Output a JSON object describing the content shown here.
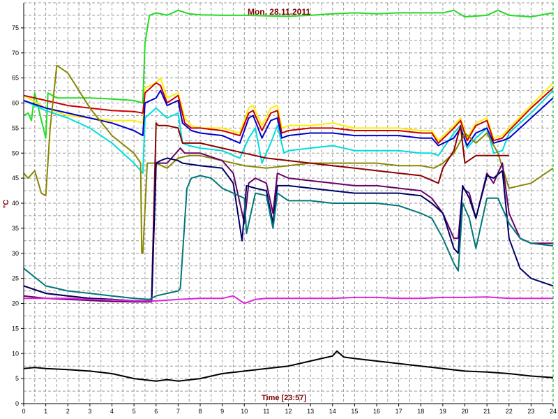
{
  "chart_data": {
    "type": "line",
    "title": "Mon. 28.11.2011",
    "xlabel": "Time [23:57]",
    "ylabel": "°C",
    "xlim": [
      0,
      24
    ],
    "ylim": [
      0,
      80
    ],
    "xticks": [
      "0",
      "1",
      "2",
      "3",
      "4",
      "5",
      "6",
      "7",
      "8",
      "9",
      "10",
      "11",
      "12",
      "13",
      "14",
      "15",
      "16",
      "17",
      "18",
      "19",
      "20",
      "21",
      "22",
      "23",
      "24"
    ],
    "yticks": [
      "0",
      "5",
      "10",
      "15",
      "20",
      "25",
      "30",
      "35",
      "40",
      "45",
      "50",
      "55",
      "60",
      "65",
      "70",
      "75"
    ],
    "grid": true,
    "legend": "none",
    "series": [
      {
        "color": "#22dd22",
        "x": [
          0,
          0.2,
          0.35,
          0.5,
          1,
          1.1,
          1.5,
          2,
          3,
          4,
          5,
          5.4,
          5.5,
          5.7,
          6,
          6.5,
          7,
          7.5,
          8,
          9,
          10,
          11,
          12,
          13,
          14,
          15,
          16,
          17,
          18,
          19,
          19.5,
          20,
          21,
          21.5,
          22,
          23,
          24
        ],
        "y": [
          57.5,
          58,
          56.5,
          62,
          53,
          62,
          61,
          61,
          61,
          60.8,
          60.5,
          60,
          72,
          77.5,
          78,
          77.5,
          78.5,
          77.8,
          77.6,
          77.5,
          77.5,
          77.4,
          77.3,
          77.5,
          77.8,
          78,
          77.8,
          78,
          78,
          78,
          78.5,
          77.2,
          77.5,
          78.5,
          77.5,
          77.2,
          78
        ]
      },
      {
        "color": "#ffee00",
        "x": [
          0,
          1,
          2,
          3,
          4,
          5,
          5.4,
          5.5,
          6,
          6.2,
          6.5,
          7,
          7.3,
          7.6,
          8,
          9,
          9.8,
          10.2,
          10.4,
          10.8,
          11.2,
          11.5,
          11.7,
          12,
          13,
          14,
          15,
          16,
          17,
          18,
          18.5,
          18.8,
          19.5,
          19.8,
          20.1,
          20.5,
          21,
          21.3,
          21.7,
          22,
          23,
          24
        ],
        "y": [
          61.5,
          59,
          57.5,
          57,
          56.5,
          56.5,
          56,
          63,
          64,
          65,
          61,
          62,
          57,
          55.5,
          55,
          55,
          54,
          59,
          59.5,
          55.5,
          59,
          59.5,
          55,
          55.5,
          55.5,
          56,
          55,
          55,
          55,
          54.5,
          54.5,
          52.5,
          55.5,
          57,
          53,
          56,
          57,
          53,
          53.5,
          55,
          59.5,
          64
        ]
      },
      {
        "color": "#cc0000",
        "x": [
          0,
          1,
          2,
          3,
          4,
          5,
          5.4,
          5.5,
          6,
          6.2,
          6.5,
          7,
          7.3,
          7.6,
          8,
          9,
          9.8,
          10.2,
          10.4,
          10.8,
          11.2,
          11.5,
          11.7,
          12,
          13,
          14,
          15,
          16,
          17,
          18,
          18.5,
          18.8,
          19.5,
          19.8,
          20.1,
          20.5,
          21,
          21.3,
          21.7,
          22,
          23,
          24
        ],
        "y": [
          61.5,
          60.5,
          59.5,
          59,
          58.5,
          58.3,
          58,
          62,
          64,
          63.5,
          60,
          61.5,
          56,
          55,
          55,
          54.5,
          53.5,
          58,
          58.5,
          54.5,
          58,
          58.5,
          54,
          54.5,
          55,
          55,
          54.5,
          54.5,
          54.5,
          54,
          54,
          52,
          55,
          56.5,
          52.5,
          55.5,
          56.5,
          52.5,
          53,
          54.5,
          59,
          63
        ]
      },
      {
        "color": "#00dddd",
        "x": [
          0,
          1,
          2,
          3,
          4,
          5,
          5.4,
          5.5,
          6,
          6.5,
          7,
          7.2,
          7.5,
          8,
          9,
          9.8,
          10.2,
          10.5,
          10.8,
          11.2,
          11.5,
          11.8,
          12,
          13,
          14,
          15,
          16,
          17,
          18,
          18.5,
          18.8,
          19.5,
          19.8,
          20.1,
          20.5,
          21,
          21.3,
          21.7,
          22,
          23,
          24
        ],
        "y": [
          60.5,
          58.5,
          57,
          55,
          52,
          48,
          46,
          57,
          59,
          57,
          58,
          52,
          51.5,
          51,
          50.5,
          49,
          53,
          55,
          48,
          52,
          55.5,
          50,
          50.5,
          51,
          51.5,
          50.5,
          50.5,
          50.5,
          50,
          50,
          49.5,
          54,
          55.5,
          51,
          53,
          55,
          50,
          50.5,
          54,
          58,
          62.5
        ]
      },
      {
        "color": "#0000cc",
        "x": [
          0,
          1,
          2,
          3,
          4,
          5,
          5.4,
          5.5,
          6,
          6.2,
          6.5,
          7,
          7.2,
          7.6,
          8,
          9,
          9.8,
          10.2,
          10.4,
          10.8,
          11.2,
          11.5,
          11.7,
          12,
          13,
          14,
          15,
          16,
          17,
          18,
          18.5,
          18.8,
          19.5,
          19.8,
          20.1,
          20.5,
          21,
          21.3,
          21.7,
          22,
          23,
          24
        ],
        "y": [
          60.5,
          59,
          58,
          57,
          56,
          54.5,
          53.5,
          60,
          61,
          62.5,
          59.5,
          60.5,
          56,
          54.5,
          54,
          53.5,
          52,
          57,
          57.5,
          53,
          56.5,
          57,
          53,
          53.5,
          54,
          54,
          53.5,
          53.5,
          53.5,
          53,
          53,
          51.5,
          53,
          55,
          51.5,
          54,
          55,
          52,
          52.5,
          53,
          57,
          61
        ]
      },
      {
        "color": "#888800",
        "x": [
          0,
          0.2,
          0.5,
          0.8,
          1,
          1.2,
          1.5,
          2,
          3,
          4,
          5,
          5.3,
          5.35,
          5.4,
          5.6,
          6,
          6.5,
          7,
          7.5,
          8,
          9,
          10,
          11,
          12,
          13,
          14,
          15,
          16,
          17,
          18,
          18.6,
          19,
          19.5,
          20,
          20.5,
          21,
          21.5,
          22,
          23,
          24
        ],
        "y": [
          46,
          45,
          46.5,
          42,
          41.5,
          55,
          67.5,
          66,
          59,
          53.5,
          50,
          48,
          30,
          30,
          48,
          48,
          47,
          49,
          49.5,
          49.5,
          48.5,
          47.5,
          47,
          47.5,
          48,
          48,
          48,
          48,
          47.5,
          47.5,
          47,
          48,
          50,
          54,
          52,
          54,
          50,
          43,
          44,
          47
        ]
      },
      {
        "color": "#8b0000",
        "x": [
          0,
          1,
          2,
          3,
          4,
          5,
          5.6,
          5.8,
          6,
          6.1,
          6.5,
          7,
          7.2,
          8,
          9,
          10,
          11,
          12,
          13,
          14,
          15,
          16,
          17,
          18,
          18.8,
          19,
          19.5,
          19.8,
          20,
          20.5,
          21,
          21.5,
          22
        ],
        "y": [
          23.5,
          22,
          21.5,
          21,
          20.8,
          20.5,
          20.5,
          21,
          56,
          55.5,
          55.5,
          55,
          52,
          52,
          51,
          50,
          49,
          48.5,
          48,
          47.5,
          47,
          46.5,
          46,
          45.5,
          44,
          47,
          50.5,
          55.5,
          48,
          49.5,
          49.5,
          49.5,
          49.5
        ]
      },
      {
        "color": "#660066",
        "x": [
          0,
          1,
          2,
          3,
          4,
          5,
          5.8,
          6,
          6.5,
          7,
          7.1,
          7.3,
          8,
          9,
          9.5,
          10,
          10.2,
          10.5,
          11,
          11.3,
          11.5,
          12,
          13,
          14,
          15,
          16,
          17,
          18,
          18.5,
          19,
          19.5,
          19.7,
          19.9,
          20.2,
          20.5,
          21,
          21.3,
          21.7,
          22,
          22.5,
          23,
          24
        ],
        "y": [
          21.5,
          21,
          20.8,
          20.6,
          20.4,
          20.3,
          20.3,
          48,
          48,
          50.5,
          51,
          50,
          50,
          48.5,
          46,
          36,
          44,
          45,
          44,
          38,
          46,
          45,
          44.5,
          44,
          43.5,
          43.5,
          43,
          42.5,
          41,
          38,
          33,
          33,
          43,
          42,
          37,
          46,
          44,
          48,
          38,
          33,
          32,
          32
        ]
      },
      {
        "color": "#000066",
        "x": [
          0,
          1,
          2,
          3,
          4,
          5,
          5.8,
          6,
          6.2,
          6.5,
          7,
          7.2,
          8,
          9,
          9.5,
          9.9,
          10.1,
          10.5,
          11,
          11.3,
          11.5,
          12,
          13,
          14,
          15,
          16,
          17,
          18,
          18.5,
          19,
          19.5,
          19.7,
          19.9,
          20.2,
          20.5,
          21,
          21.3,
          21.7,
          22,
          22.5,
          23,
          24
        ],
        "y": [
          23.5,
          22,
          21.5,
          21,
          20.8,
          20.5,
          20.5,
          48,
          48.5,
          49,
          48.5,
          48,
          47.5,
          47,
          44,
          32.5,
          43.5,
          43,
          42.5,
          36,
          43.5,
          43.5,
          43,
          42.5,
          42,
          42,
          42,
          41.5,
          40,
          38,
          31,
          30,
          43.5,
          41,
          37,
          45.5,
          45,
          46.5,
          33,
          27,
          25,
          23.5
        ]
      },
      {
        "color": "#007777",
        "x": [
          0,
          1,
          2,
          3,
          4,
          5,
          5.7,
          6,
          6.5,
          7,
          7.1,
          7.4,
          7.6,
          8,
          8.5,
          9,
          9.5,
          10,
          10.1,
          10.5,
          11,
          11.3,
          11.5,
          12,
          13,
          14,
          15,
          16,
          17,
          18,
          18.5,
          19,
          19.5,
          19.7,
          19.9,
          20.2,
          20.5,
          21,
          21.3,
          21.5,
          22,
          22.5,
          23,
          24
        ],
        "y": [
          27,
          23.5,
          22.5,
          22,
          21.5,
          21,
          20.8,
          21.5,
          22,
          22.5,
          23,
          43,
          45,
          45.5,
          45,
          43,
          42,
          41,
          34,
          42,
          41.5,
          35,
          42,
          40.5,
          40.5,
          40,
          40,
          40,
          39.5,
          38,
          37,
          33,
          28,
          26.5,
          40,
          37,
          31,
          41,
          41,
          41,
          36,
          33,
          32,
          31.5
        ]
      },
      {
        "color": "#dd22dd",
        "x": [
          0,
          1,
          2,
          3,
          4,
          5,
          6,
          7,
          8,
          9,
          9.5,
          10,
          10.5,
          11,
          12,
          13,
          14,
          15,
          16,
          17,
          18,
          19,
          20,
          21,
          22,
          23,
          24
        ],
        "y": [
          21,
          21,
          21,
          20.8,
          20.7,
          20.5,
          20.5,
          20.8,
          21,
          21,
          21.5,
          20,
          20.8,
          21,
          21,
          21,
          21,
          21.2,
          21.2,
          21,
          21,
          21.2,
          21.2,
          21.3,
          21,
          21,
          21
        ]
      },
      {
        "color": "#000000",
        "x": [
          0,
          0.5,
          1,
          2,
          3,
          4,
          5,
          6,
          6.5,
          7,
          8,
          9,
          10,
          11,
          12,
          13,
          13.5,
          14,
          14.2,
          14.5,
          15,
          16,
          17,
          18,
          19,
          20,
          21,
          22,
          23,
          24
        ],
        "y": [
          7,
          7.2,
          7,
          6.8,
          6.5,
          6,
          5,
          4.5,
          4.8,
          4.5,
          5,
          6,
          6.5,
          7,
          7.5,
          8.5,
          9,
          9.5,
          10.5,
          9.3,
          9,
          8.5,
          8,
          7.5,
          7,
          6.5,
          6.3,
          6,
          5.5,
          5.2
        ]
      }
    ]
  }
}
